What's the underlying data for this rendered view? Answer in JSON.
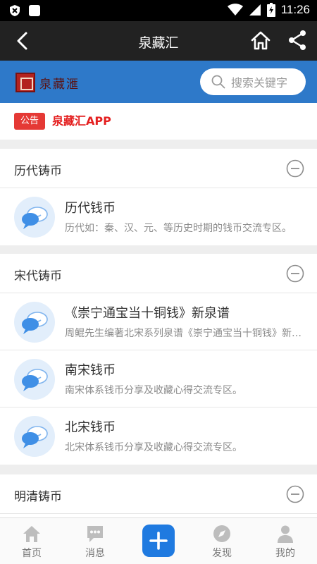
{
  "status_bar": {
    "time": "11:26"
  },
  "header": {
    "title": "泉藏汇"
  },
  "banner": {
    "logo_text": "泉藏滙",
    "search_placeholder": "搜索关键字"
  },
  "notice": {
    "badge": "公告",
    "text": "泉藏汇APP"
  },
  "sections": [
    {
      "title": "历代铸币",
      "items": [
        {
          "title": "历代钱币",
          "desc": "历代如：秦、汉、元、等历史时期的钱币交流专区。"
        }
      ]
    },
    {
      "title": "宋代铸币",
      "items": [
        {
          "title": "《崇宁通宝当十铜钱》新泉谱",
          "desc": "周鲲先生编著北宋系列泉谱《崇宁通宝当十铜钱》新泉谱"
        },
        {
          "title": "南宋钱币",
          "desc": "南宋体系钱币分享及收藏心得交流专区。"
        },
        {
          "title": "北宋钱币",
          "desc": "北宋体系钱币分享及收藏心得交流专区。"
        }
      ]
    },
    {
      "title": "明清铸币",
      "items": []
    }
  ],
  "bottom_nav": [
    {
      "label": "首页",
      "icon": "home-icon"
    },
    {
      "label": "消息",
      "icon": "message-icon"
    },
    {
      "label": "",
      "icon": "add-icon"
    },
    {
      "label": "发现",
      "icon": "compass-icon"
    },
    {
      "label": "我的",
      "icon": "person-icon"
    }
  ],
  "colors": {
    "accent": "#1f7ae0",
    "banner": "#2e79c9",
    "notice_red": "#e41f1f",
    "titlebar": "#222222"
  }
}
